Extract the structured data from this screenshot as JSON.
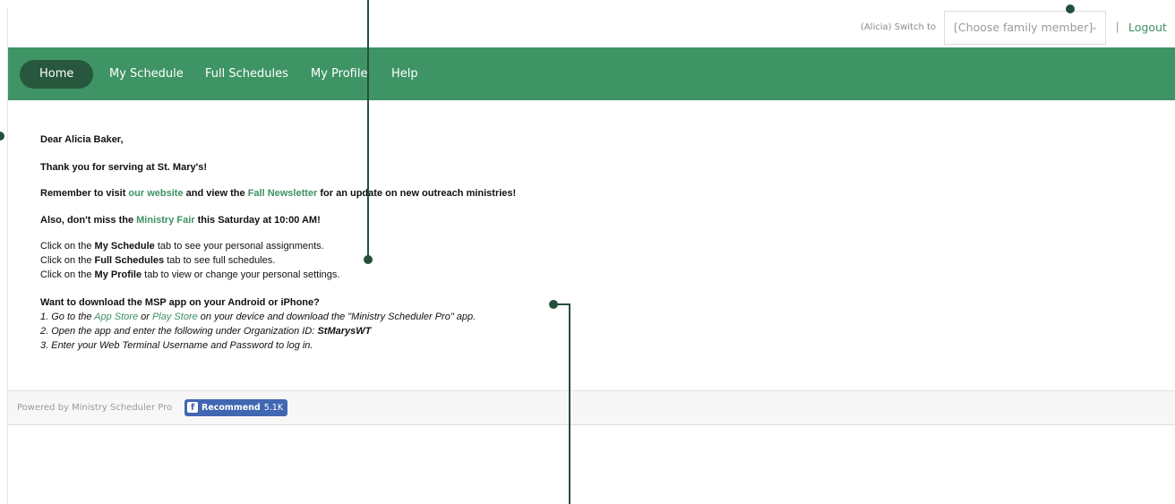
{
  "header": {
    "switch_label": "(Alicia) Switch to",
    "family_select_value": "[Choose family member]",
    "separator": "|",
    "logout_label": "Logout"
  },
  "nav": {
    "items": [
      "Home",
      "My Schedule",
      "Full Schedules",
      "My Profile",
      "Help"
    ],
    "active": "Home",
    "color": "#3f9465",
    "active_color": "#27573c"
  },
  "message": {
    "greeting": "Dear Alicia Baker,",
    "thanks": "Thank you for serving at St. Mary's!",
    "remember_prefix": "Remember to visit ",
    "website_link": "our website",
    "remember_mid": " and view the ",
    "newsletter_link": "Fall Newsletter",
    "remember_suffix": " for an update on new outreach ministries!",
    "fair_prefix": "Also, don't miss the ",
    "fair_link": "Ministry Fair",
    "fair_suffix": " this Saturday at 10:00 AM!"
  },
  "instructions": [
    {
      "prefix": "Click on the ",
      "tab": "My Schedule",
      "suffix": " tab to see your personal assignments."
    },
    {
      "prefix": "Click on the ",
      "tab": "Full Schedules",
      "suffix": " tab to see full schedules."
    },
    {
      "prefix": "Click on the ",
      "tab": "My Profile",
      "suffix": " tab to view or change your personal settings."
    }
  ],
  "app": {
    "heading": "Want to download the MSP app on your Android or iPhone?",
    "step1_prefix": "1. Go to the ",
    "app_store": "App Store",
    "step1_or": " or ",
    "play_store": "Play Store",
    "step1_suffix": " on your device and download the \"Ministry Scheduler Pro\" app.",
    "step2_prefix": "2. Open the app and enter the following under Organization ID: ",
    "org_id": "StMarysWT",
    "step3": "3. Enter your Web Terminal Username and Password to log in."
  },
  "footer": {
    "powered_by": "Powered by Ministry Scheduler Pro",
    "fb_label": "Recommend",
    "fb_count": "5.1K",
    "fb_color": "#4267b2"
  },
  "colors": {
    "link": "#3d9163",
    "callout": "#24513a"
  }
}
